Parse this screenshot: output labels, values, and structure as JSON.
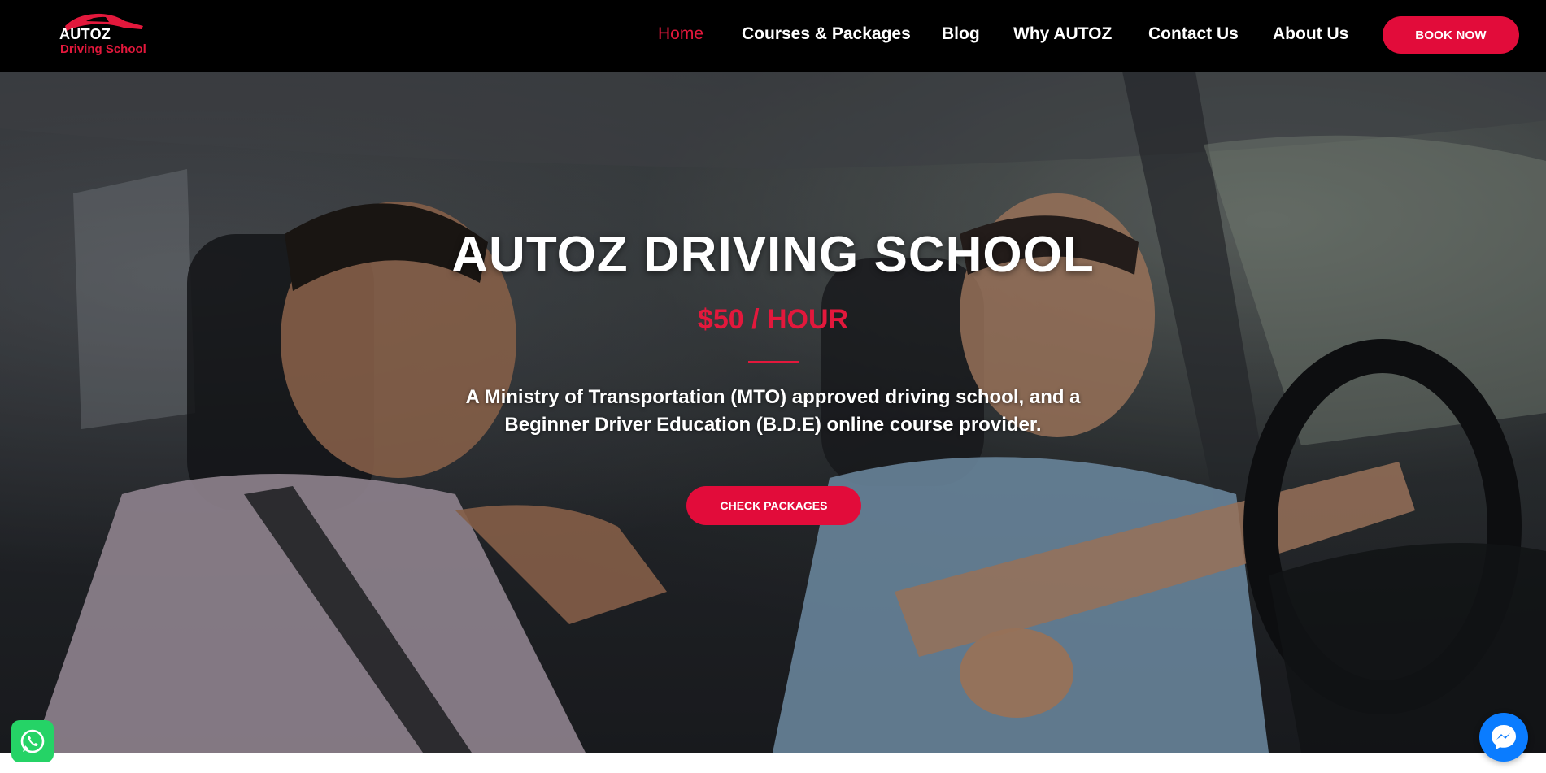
{
  "brand": {
    "logo_line1": "AUTOZ",
    "logo_line2": "Driving School",
    "accent_color": "#e3183c",
    "icon": "car-icon"
  },
  "nav": {
    "items": [
      {
        "label": "Home",
        "active": true
      },
      {
        "label": "Courses & Packages",
        "active": false
      },
      {
        "label": "Blog",
        "active": false
      },
      {
        "label": "Why AUTOZ",
        "active": false
      },
      {
        "label": "Contact Us",
        "active": false
      },
      {
        "label": "About Us",
        "active": false
      }
    ],
    "cta_label": "BOOK NOW"
  },
  "hero": {
    "title": "AUTOZ DRIVING SCHOOL",
    "price": "$50 / HOUR",
    "description": "A Ministry of Transportation (MTO) approved driving school, and a Beginner Driver Education (B.D.E) online course provider.",
    "cta_label": "CHECK PACKAGES",
    "background": "instructor-and-student-in-car-photo"
  },
  "widgets": {
    "left": "whatsapp-icon",
    "right": "messenger-icon"
  }
}
